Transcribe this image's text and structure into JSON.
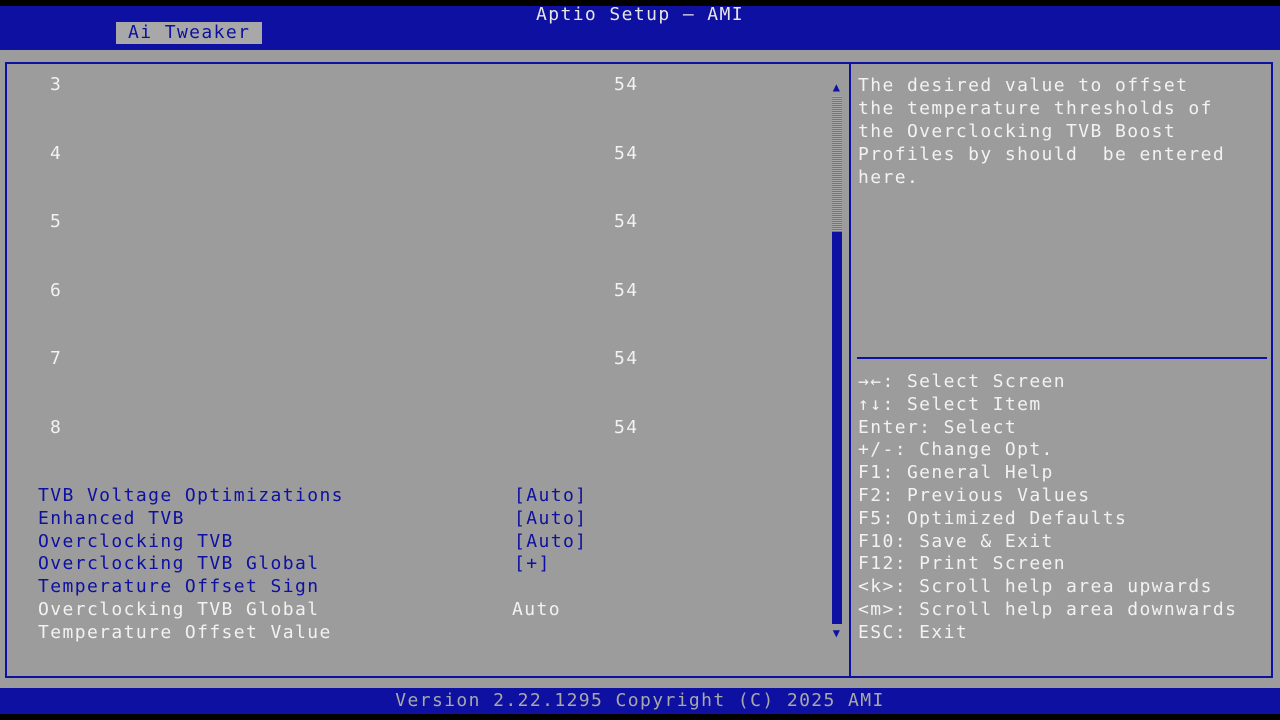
{
  "header": {
    "title": "Aptio Setup – AMI",
    "active_tab": "Ai Tweaker"
  },
  "settings": {
    "numbered_rows": [
      {
        "index": "3",
        "value": "54"
      },
      {
        "index": "4",
        "value": "54"
      },
      {
        "index": "5",
        "value": "54"
      },
      {
        "index": "6",
        "value": "54"
      },
      {
        "index": "7",
        "value": "54"
      },
      {
        "index": "8",
        "value": "54"
      }
    ],
    "items": [
      {
        "label": "TVB Voltage Optimizations",
        "value": "[Auto]"
      },
      {
        "label": "Enhanced TVB",
        "value": "[Auto]"
      },
      {
        "label": "Overclocking TVB",
        "value": "[Auto]"
      },
      {
        "label": "Overclocking TVB Global",
        "value": "[+]"
      },
      {
        "label": "Temperature Offset Sign",
        "value": ""
      },
      {
        "label": "Overclocking TVB Global",
        "value": "Auto"
      },
      {
        "label": "Temperature Offset Value",
        "value": ""
      }
    ]
  },
  "help": {
    "lines": [
      "The desired value to offset",
      "the temperature thresholds of",
      "the Overclocking TVB Boost",
      "Profiles by should  be entered",
      "here."
    ]
  },
  "keys": [
    "→←: Select Screen",
    "↑↓: Select Item",
    "Enter: Select",
    "+/-: Change Opt.",
    "F1: General Help",
    "F2: Previous Values",
    "F5: Optimized Defaults",
    "F10: Save & Exit",
    "F12: Print Screen",
    "<k>: Scroll help area upwards",
    "<m>: Scroll help area downwards",
    "ESC: Exit"
  ],
  "scroll": {
    "up_glyph": "▲",
    "down_glyph": "▼",
    "position_fraction": 0
  },
  "footer": {
    "version_text": "Version 2.22.1295 Copyright (C) 2025 AMI"
  },
  "colors": {
    "brand_blue": "#0d10a0",
    "panel_gray": "#9c9c9c",
    "text_white": "#f2f2f2"
  }
}
